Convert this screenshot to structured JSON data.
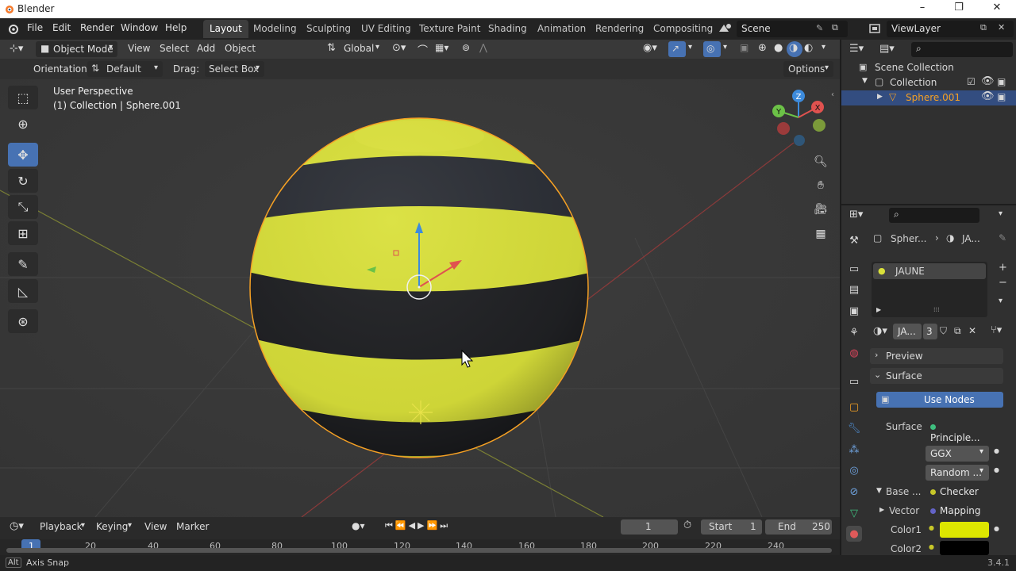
{
  "window": {
    "title": "Blender",
    "minimize": "–",
    "maximize": "❐",
    "close": "✕"
  },
  "menu": {
    "file": "File",
    "edit": "Edit",
    "render": "Render",
    "window": "Window",
    "help": "Help"
  },
  "workspaces": [
    "Layout",
    "Modeling",
    "Sculpting",
    "UV Editing",
    "Texture Paint",
    "Shading",
    "Animation",
    "Rendering",
    "Compositing"
  ],
  "scene": {
    "name": "Scene",
    "view_layer": "ViewLayer"
  },
  "viewport_header": {
    "mode": "Object Mode",
    "view": "View",
    "select": "Select",
    "add": "Add",
    "object": "Object",
    "transform_orientation": "Global"
  },
  "tool_settings": {
    "orientation_label": "Orientation:",
    "orientation_value": "Default",
    "drag_label": "Drag:",
    "drag_value": "Select Box",
    "options": "Options"
  },
  "overlay_text": {
    "line1": "User Perspective",
    "line2": "(1) Collection | Sphere.001"
  },
  "gizmo": {
    "x": "X",
    "y": "Y",
    "z": "Z"
  },
  "outliner": {
    "scene_collection": "Scene Collection",
    "collection": "Collection",
    "object": "Sphere.001"
  },
  "properties": {
    "breadcrumb_object": "Spher...",
    "breadcrumb_material": "JA...",
    "material_slot": "JAUNE",
    "material_name": "JA...",
    "user_count": "3",
    "preview": "Preview",
    "surface_panel": "Surface",
    "use_nodes": "Use Nodes",
    "surface_label": "Surface",
    "surface_value": "Principle...",
    "distribution": "GGX",
    "subsurface": "Random ...",
    "base_label": "Base ...",
    "base_value": "Checker ...",
    "vector_label": "Vector",
    "vector_value": "Mapping",
    "color1_label": "Color1",
    "color2_label": "Color2",
    "color1": "#dde600",
    "color2": "#000000"
  },
  "timeline": {
    "playback": "Playback",
    "keying": "Keying",
    "view": "View",
    "marker": "Marker",
    "current_frame": "1",
    "start_label": "Start",
    "start": "1",
    "end_label": "End",
    "end": "250",
    "ruler": [
      "1",
      "20",
      "40",
      "60",
      "80",
      "100",
      "120",
      "140",
      "160",
      "180",
      "200",
      "220",
      "240"
    ]
  },
  "status": {
    "key": "Alt",
    "hint": "Axis Snap",
    "version": "3.4.1"
  },
  "colors": {
    "accent": "#4772b3",
    "selection_orange": "#f5a024",
    "sphere_yellow": "#d9e03a",
    "sphere_dark": "#232428"
  }
}
